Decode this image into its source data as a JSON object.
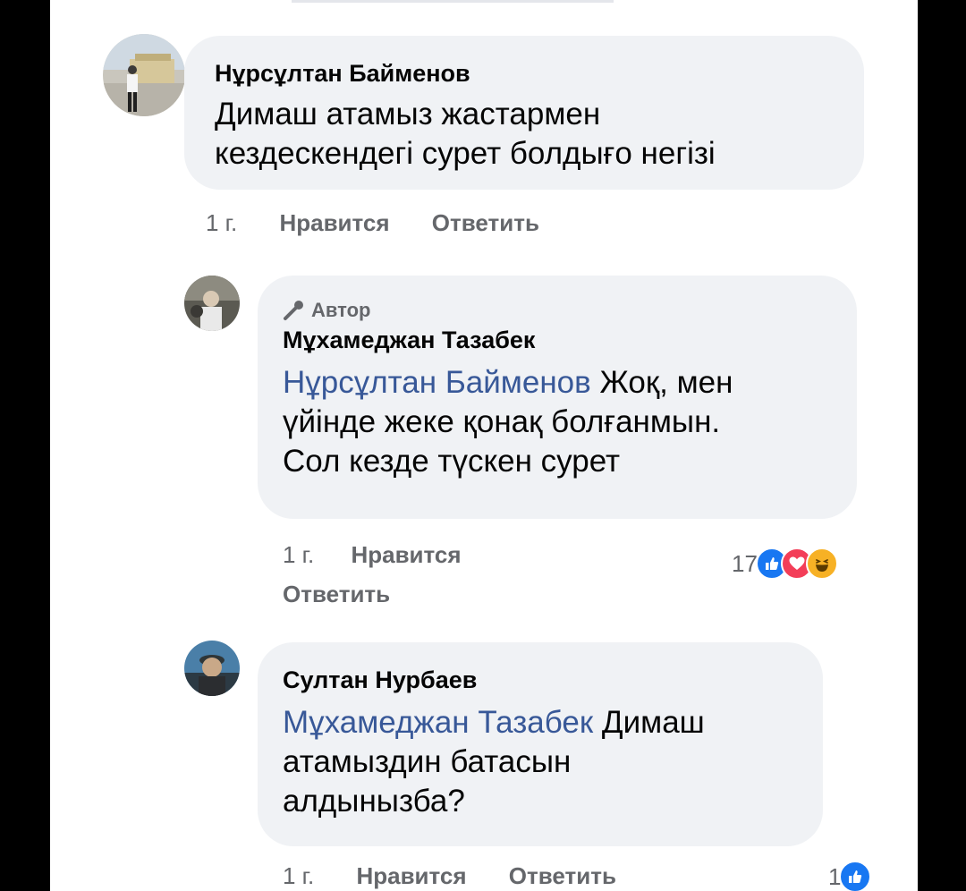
{
  "comments": [
    {
      "author": "Нұрсұлтан Байменов",
      "text_lines": [
        "Димаш атамыз жастармен",
        "кездескендегі сурет болдығо негізі"
      ],
      "time": "1 г.",
      "like_label": "Нравится",
      "reply_label": "Ответить"
    },
    {
      "badge": "Автор",
      "author": "Мұхамеджан Тазабек",
      "mention": "Нұрсұлтан Байменов",
      "text_line1_rest": " Жоқ, мен",
      "text_line2": "үйінде жеке қонақ болғанмын.",
      "text_line3": "Сол кезде түскен сурет",
      "time": "1 г.",
      "like_label": "Нравится",
      "reply_label": "Ответить",
      "reaction_count": "17",
      "reactions": [
        "like-icon",
        "love-icon",
        "haha-icon"
      ]
    },
    {
      "author": "Султан Нурбаев",
      "mention": "Мұхамеджан Тазабек",
      "text_line1_rest": " Димаш",
      "text_line2": "атамыздин батасын",
      "text_line3": "алдынызба?",
      "time": "1 г.",
      "like_label": "Нравится",
      "reply_label": "Ответить",
      "reaction_count": "1",
      "reactions": [
        "like-icon"
      ]
    }
  ],
  "colors": {
    "bubble": "#f0f2f5",
    "mention": "#385898",
    "meta": "#65676b",
    "like": "#1877f2",
    "love": "#f33e58",
    "haha": "#f7b125"
  }
}
